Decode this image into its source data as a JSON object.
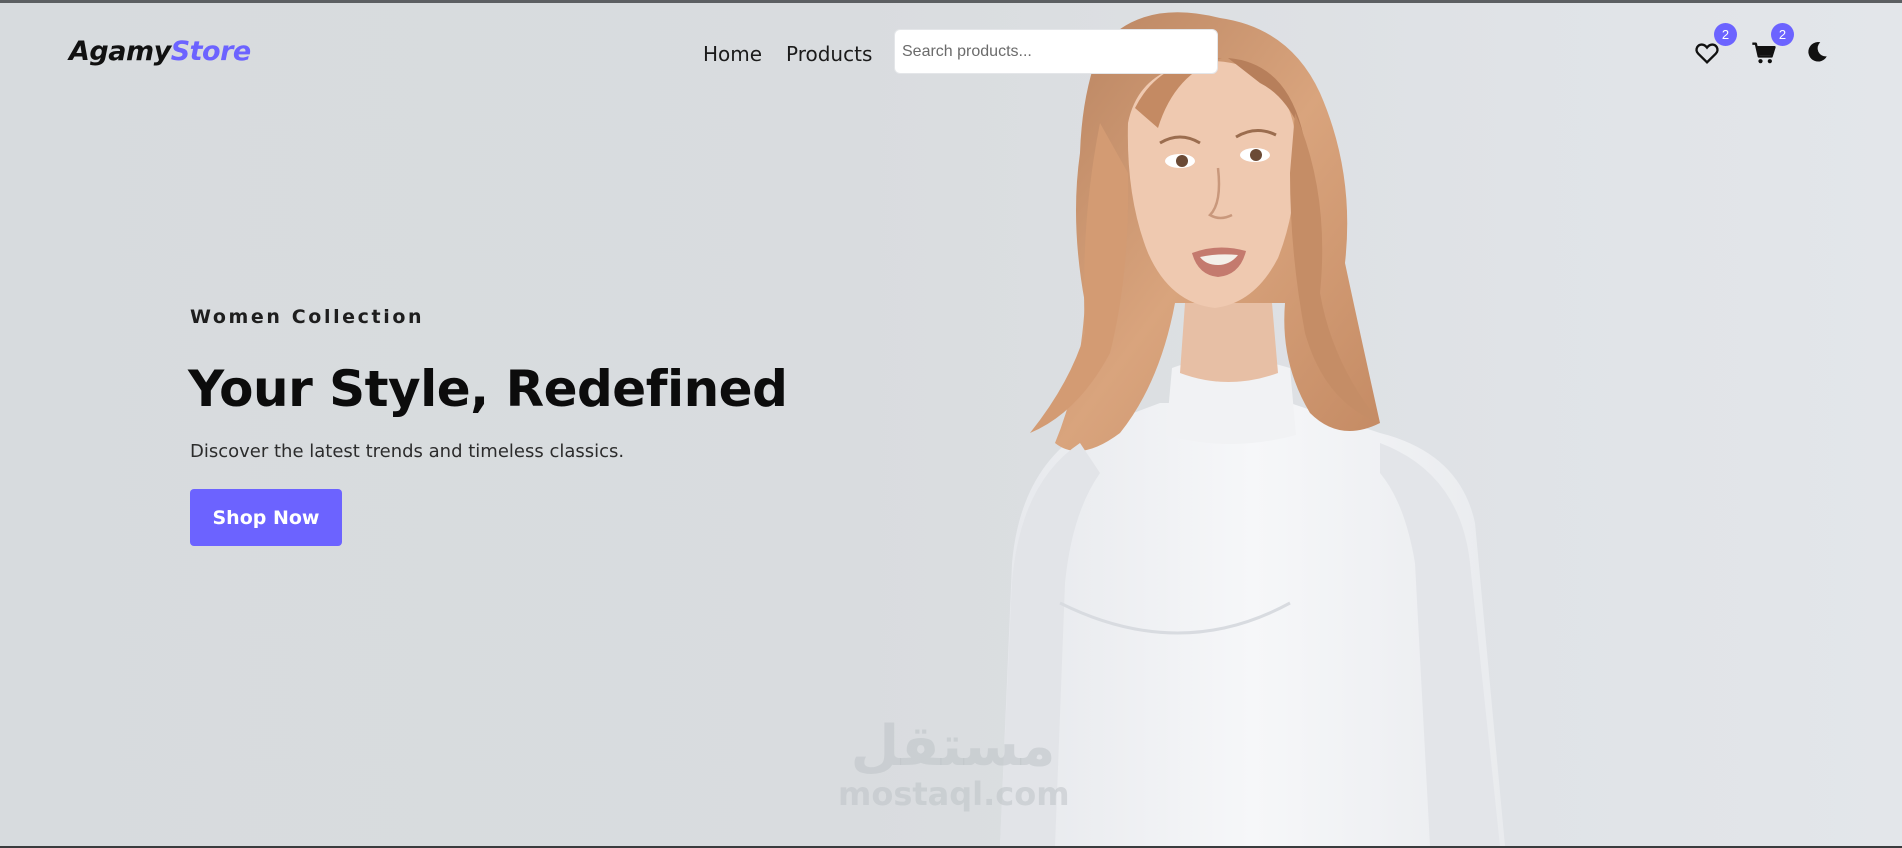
{
  "brand": {
    "name_main": "Agamy",
    "name_accent": "Store",
    "accent_color": "#6c63ff"
  },
  "nav": {
    "home": "Home",
    "products": "Products"
  },
  "search": {
    "placeholder": "Search products...",
    "value": ""
  },
  "header_icons": {
    "wishlist": {
      "icon": "heart-icon",
      "count": "2"
    },
    "cart": {
      "icon": "cart-icon",
      "count": "2"
    },
    "theme": {
      "icon": "moon-icon"
    }
  },
  "hero": {
    "subtitle": "Women Collection",
    "title": "Your Style, Redefined",
    "description": "Discover the latest trends and timeless classics.",
    "cta_label": "Shop Now",
    "image": "woman-in-white-turtleneck"
  },
  "watermark": {
    "arabic": "مستقل",
    "latin": "mostaql.com"
  }
}
